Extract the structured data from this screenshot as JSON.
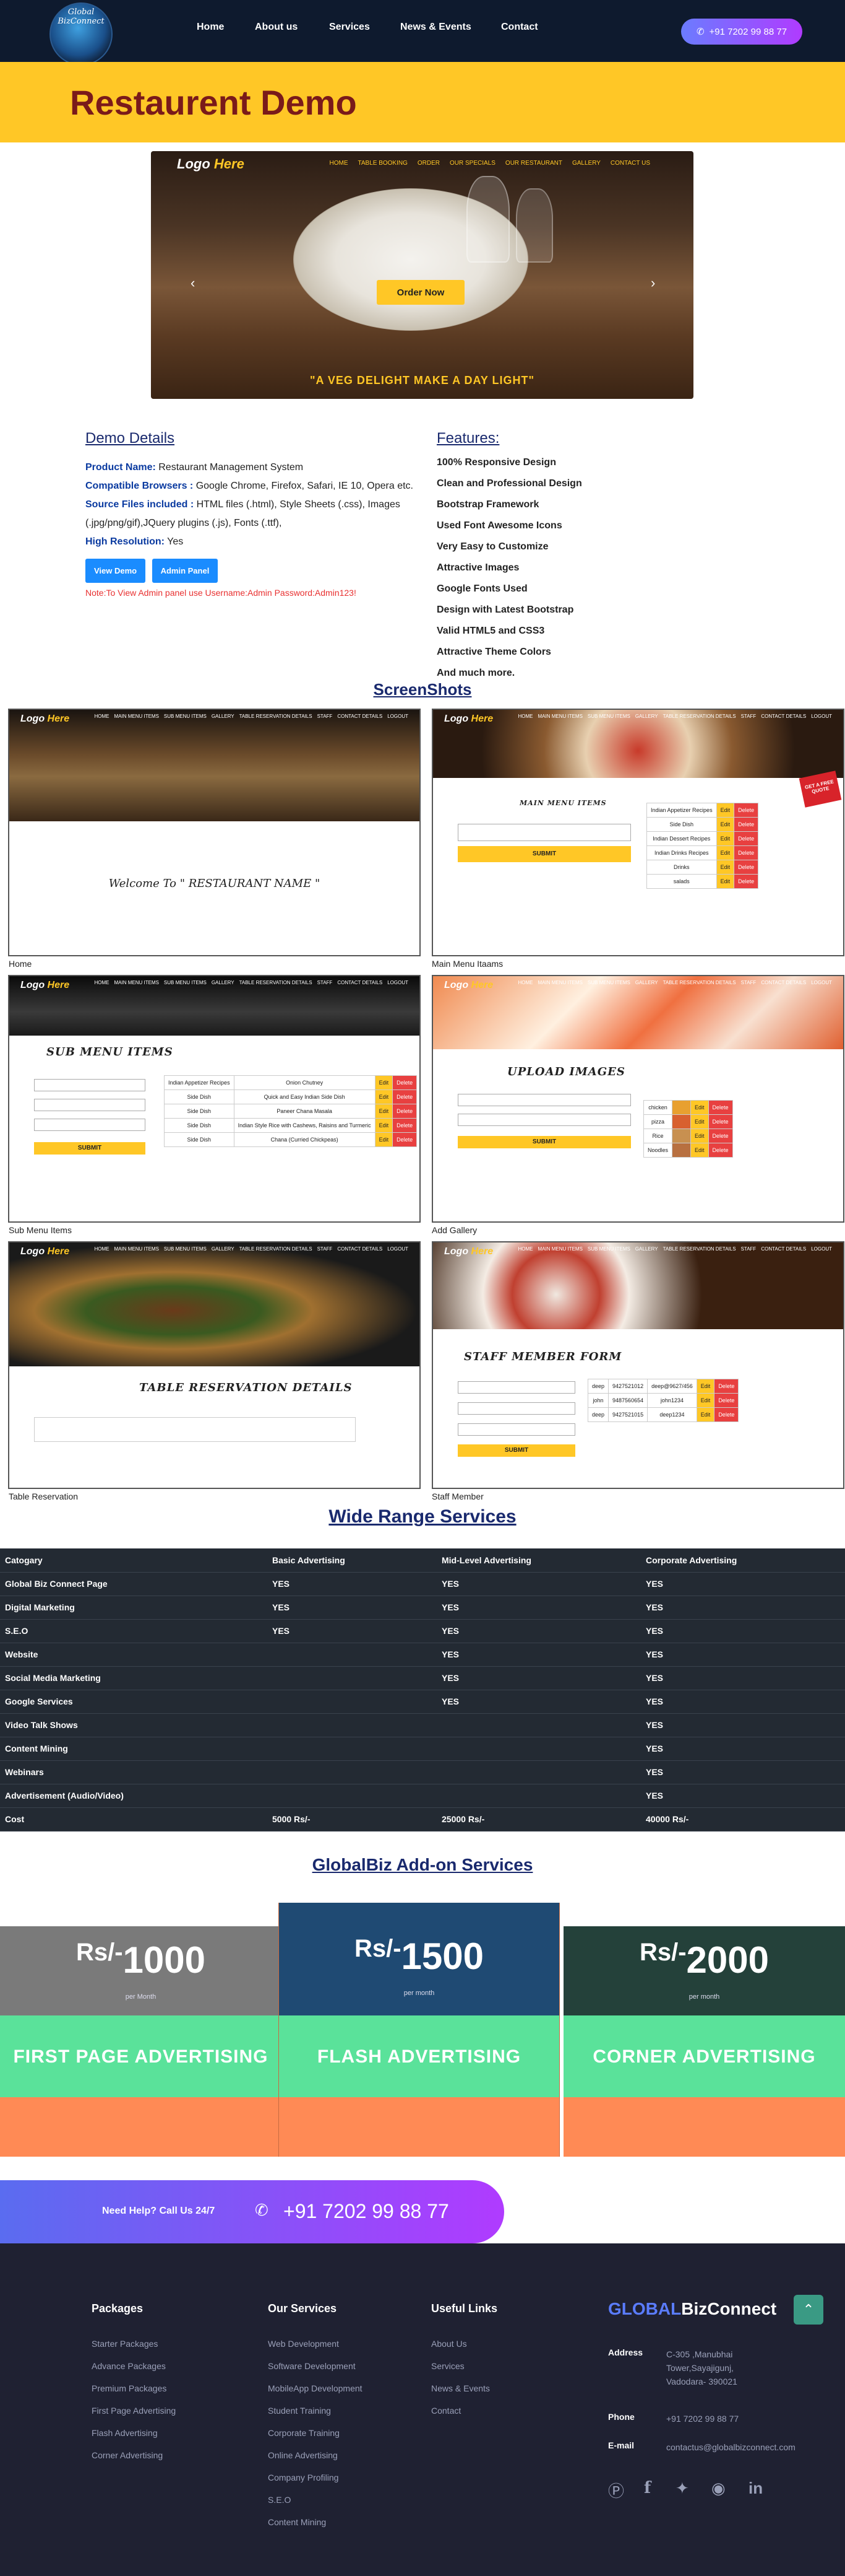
{
  "nav": {
    "logo_text": "Global BizConnect",
    "links": [
      "Home",
      "About us",
      "Services",
      "News & Events",
      "Contact"
    ],
    "phone": "+91 7202 99 88 77"
  },
  "hero_title": "Restaurent Demo",
  "slider": {
    "logo_main": "Logo",
    "logo_accent": "Here",
    "menu": [
      "HOME",
      "TABLE BOOKING",
      "ORDER",
      "OUR SPECIALS",
      "OUR RESTAURANT",
      "GALLERY",
      "CONTACT US"
    ],
    "button": "Order Now",
    "prev": "‹",
    "next": "›",
    "tagline": "\"A VEG DELIGHT MAKE A DAY LIGHT\""
  },
  "demo": {
    "heading": "Demo Details",
    "rows": [
      {
        "key": "Product Name:",
        "val": " Restaurant Management System"
      },
      {
        "key": "Compatible Browsers :",
        "val": "  Google Chrome, Firefox, Safari, IE 10, Opera etc."
      },
      {
        "key": "Source Files included :",
        "val": "  HTML files (.html), Style Sheets (.css), Images (.jpg/png/gif),JQuery plugins (.js), Fonts (.ttf),"
      },
      {
        "key": "High Resolution:",
        "val": " Yes"
      }
    ],
    "btn_demo": "View Demo",
    "btn_admin": "Admin Panel",
    "note": "Note:To View Admin panel use Username:Admin Password:Admin123!"
  },
  "features": {
    "heading": "Features:",
    "items": [
      "100% Responsive Design",
      "Clean and Professional Design",
      "Bootstrap Framework",
      "Used Font Awesome Icons",
      "Very Easy to Customize",
      "Attractive Images",
      "Google Fonts Used",
      "Design with Latest Bootstrap",
      "Valid HTML5 and CSS3",
      "Attractive Theme Colors",
      "And much more."
    ]
  },
  "screenshots": {
    "heading": "ScreenShots",
    "labels": [
      "Home",
      "Main Menu Itaams",
      "Sub Menu Items",
      "Add Gallery",
      "Table Reservation",
      "Staff Member"
    ],
    "logo_main": "Logo",
    "logo_accent": "Here",
    "admin_menu": [
      "HOME",
      "MAIN MENU ITEMS",
      "SUB MENU ITEMS",
      "GALLERY",
      "TABLE RESERVATION DETAILS",
      "STAFF",
      "CONTACT DETAILS",
      "LOGOUT"
    ],
    "welcome": "Welcome To \" RESTAURANT NAME \"",
    "main_menu_heading": "MAIN MENU ITEMS",
    "sub_menu_heading": "SUB MENU ITEMS",
    "upload_heading": "UPLOAD IMAGES",
    "reservation_heading": "TABLE RESERVATION DETAILS",
    "staff_heading": "STAFF MEMBER FORM",
    "submit": "SUBMIT",
    "edit": "Edit",
    "delete": "Delete",
    "badge": "GET A FREE QUOTE",
    "main_menu_rows": [
      "Indian Appetizer Recipes",
      "Side Dish",
      "Indian Dessert Recipes",
      "Indian Drinks Recipes",
      "Drinks",
      "salads"
    ],
    "sub_menu_rows": [
      [
        "Indian Appetizer Recipes",
        "Onion Chutney"
      ],
      [
        "Side Dish",
        "Quick and Easy Indian Side Dish"
      ],
      [
        "Side Dish",
        "Paneer Chana Masala"
      ],
      [
        "Side Dish",
        "Indian Style Rice with Cashews, Raisins and Turmeric"
      ],
      [
        "Side Dish",
        "Chana (Curried Chickpeas)"
      ]
    ],
    "gallery_rows": [
      "chicken",
      "pizza",
      "Rice",
      "Noodles"
    ],
    "staff_rows": [
      [
        "deep",
        "9427521012",
        "deep@9627/456"
      ],
      [
        "john",
        "9487560654",
        "john1234"
      ],
      [
        "deep",
        "9427521015",
        "deep1234"
      ]
    ]
  },
  "wide_range": {
    "heading": "Wide Range Services",
    "columns": [
      "Catogary",
      "Basic Advertising",
      "Mid-Level Advertising",
      "Corporate Advertising"
    ],
    "rows": [
      [
        "Global Biz Connect Page",
        "YES",
        "YES",
        "YES"
      ],
      [
        "Digital Marketing",
        "YES",
        "YES",
        "YES"
      ],
      [
        "S.E.O",
        "YES",
        "YES",
        "YES"
      ],
      [
        "Website",
        "",
        "YES",
        "YES"
      ],
      [
        "Social Media Marketing",
        "",
        "YES",
        "YES"
      ],
      [
        "Google Services",
        "",
        "YES",
        "YES"
      ],
      [
        "Video Talk Shows",
        "",
        "",
        "YES"
      ],
      [
        "Content Mining",
        "",
        "",
        "YES"
      ],
      [
        "Webinars",
        "",
        "",
        "YES"
      ],
      [
        "Advertisement (Audio/Video)",
        "",
        "",
        "YES"
      ],
      [
        "Cost",
        "5000 Rs/-",
        "25000 Rs/-",
        "40000 Rs/-"
      ]
    ]
  },
  "addon": {
    "heading": "GlobalBiz Add-on Services",
    "plans": [
      {
        "rs": "Rs/-",
        "amount": "1000",
        "per": "per Month",
        "feature": "FIRST PAGE ADVERTISING",
        "head_color": "#7a7a7a"
      },
      {
        "rs": "Rs/-",
        "amount": "1500",
        "per": "per month",
        "feature": "FLASH ADVERTISING",
        "head_color": "#1f4a73"
      },
      {
        "rs": "Rs/-",
        "amount": "2000",
        "per": "per month",
        "feature": "CORNER ADVERTISING",
        "head_color": "#24413a"
      }
    ],
    "green": "#5ae29a",
    "orange": "#ff8a55"
  },
  "help": {
    "text": "Need Help? Call Us 24/7",
    "phone": "+91 7202 99 88 77"
  },
  "footer": {
    "packages_heading": "Packages",
    "packages": [
      "Starter Packages",
      "Advance Packages",
      "Premium Packages",
      "First Page Advertising",
      "Flash Advertising",
      "Corner Advertising"
    ],
    "services_heading": "Our Services",
    "services": [
      "Web Development",
      "Software Development",
      "MobileApp Development",
      "Student Training",
      "Corporate Training",
      "Online Advertising",
      "Company Profiling",
      "S.E.O",
      "Content Mining"
    ],
    "links_heading": "Useful Links",
    "links": [
      "About Us",
      "Services",
      "News & Events",
      "Contact"
    ],
    "brand_accent": "GLOBAL",
    "brand_rest": "BizConnect",
    "address_label": "Address",
    "address": [
      "C-305 ,Manubhai",
      "Tower,Sayajigunj,",
      "Vadodara- 390021"
    ],
    "phone_label": "Phone",
    "phone": "+91 7202 99 88 77",
    "email_label": "E-mail",
    "email": "contactus@globalbizconnect.com",
    "social_icons": [
      "pinterest-icon",
      "facebook-icon",
      "twitter-icon",
      "dribbble-icon",
      "linkedin-icon"
    ]
  }
}
